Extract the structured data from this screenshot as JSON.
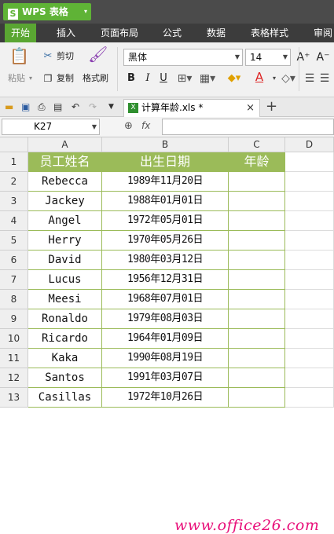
{
  "app": {
    "title": "WPS 表格",
    "logo_letter": "S",
    "caret": "▾"
  },
  "menu": {
    "tabs": [
      "开始",
      "插入",
      "页面布局",
      "公式",
      "数据",
      "表格样式",
      "审阅"
    ],
    "active": "开始",
    "accent": "#5aa632"
  },
  "ribbon": {
    "paste": "粘贴",
    "paste_caret": "▾",
    "cut": "剪切",
    "copy": "复制",
    "format_painter": "格式刷",
    "font_name": "黑体",
    "font_size": "14",
    "grow_font": "A⁺",
    "shrink_font": "A⁻",
    "bold": "B",
    "italic": "I",
    "underline": "U",
    "font_color_letter": "A"
  },
  "doc_tab": {
    "name": "计算年龄.xls *",
    "close": "×",
    "add": "+"
  },
  "formula": {
    "cell_ref": "K27",
    "fx": "fx",
    "zoom_glyph": "⊕",
    "value": ""
  },
  "columns": [
    "A",
    "B",
    "C",
    "D"
  ],
  "rows": [
    "1",
    "2",
    "3",
    "4",
    "5",
    "6",
    "7",
    "8",
    "9",
    "10",
    "11",
    "12",
    "13"
  ],
  "table": {
    "headers": [
      "员工姓名",
      "出生日期",
      "年龄"
    ],
    "data": [
      [
        "Rebecca",
        "1989年11月20日",
        ""
      ],
      [
        "Jackey",
        "1988年01月01日",
        ""
      ],
      [
        "Angel",
        "1972年05月01日",
        ""
      ],
      [
        "Herry",
        "1970年05月26日",
        ""
      ],
      [
        "David",
        "1980年03月12日",
        ""
      ],
      [
        "Lucus",
        "1956年12月31日",
        ""
      ],
      [
        "Meesi",
        "1968年07月01日",
        ""
      ],
      [
        "Ronaldo",
        "1979年08月03日",
        ""
      ],
      [
        "Ricardo",
        "1964年01月09日",
        ""
      ],
      [
        "Kaka",
        "1990年08月19日",
        ""
      ],
      [
        "Santos",
        "1991年03月07日",
        ""
      ],
      [
        "Casillas",
        "1972年10月26日",
        ""
      ]
    ],
    "header_color": "#9bbb59"
  },
  "watermark": "www.office26.com"
}
